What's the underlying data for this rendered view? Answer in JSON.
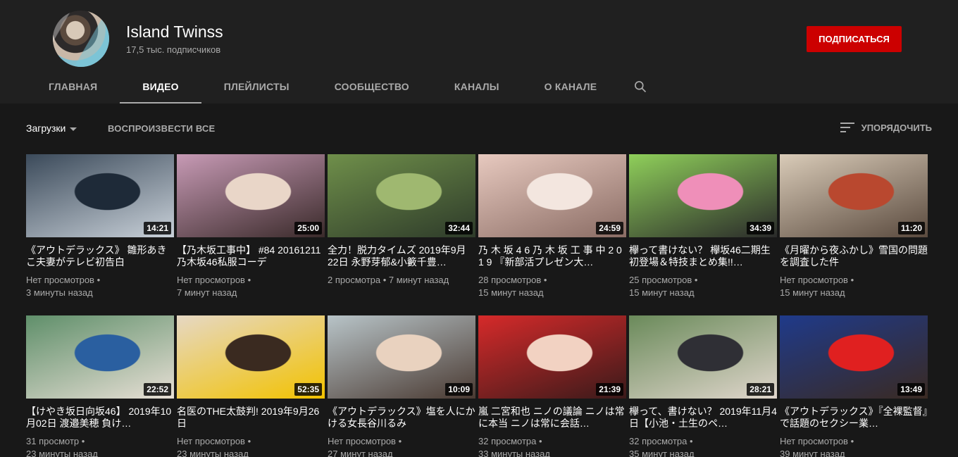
{
  "channel": {
    "name": "Island Twinss",
    "subscribers": "17,5 тыс. подписчиков",
    "subscribe_label": "ПОДПИСАТЬСЯ"
  },
  "tabs": [
    {
      "label": "ГЛАВНАЯ"
    },
    {
      "label": "ВИДЕО"
    },
    {
      "label": "ПЛЕЙЛИСТЫ"
    },
    {
      "label": "СООБЩЕСТВО"
    },
    {
      "label": "КАНАЛЫ"
    },
    {
      "label": "О КАНАЛЕ"
    }
  ],
  "filter": {
    "uploads_label": "Загрузки",
    "play_all_label": "ВОСПРОИЗВЕСТИ ВСЕ",
    "sort_label": "УПОРЯДОЧИТЬ"
  },
  "videos": [
    {
      "title": "《アウトデラックス》 雛形あきこ夫妻がテレビ初告白",
      "duration": "14:21",
      "views": "Нет просмотров •",
      "age": "3 минуты назад",
      "colors": [
        "#3b4a5a",
        "#1e2a38",
        "#c8d0d8"
      ]
    },
    {
      "title": "【乃木坂工事中】 #84 20161211 乃木坂46私服コーデ",
      "duration": "25:00",
      "views": "Нет просмотров •",
      "age": "7 минут назад",
      "colors": [
        "#c79ab5",
        "#e9d6c8",
        "#3a2a2a"
      ]
    },
    {
      "title": "全力！脱力タイムズ 2019年9月22日 永野芽郁&小籔千豊…",
      "duration": "32:44",
      "views": "2 просмотра • 7 минут назад",
      "age": "",
      "colors": [
        "#6f8f4a",
        "#9fb870",
        "#2e3b2a"
      ]
    },
    {
      "title": "乃 木 坂 4 6 乃 木 坂 工 事 中 2 0 1 9 『新部活プレゼン大…",
      "duration": "24:59",
      "views": "28 просмотров •",
      "age": "15 минут назад",
      "colors": [
        "#e7c9bf",
        "#f3e6df",
        "#8a6c64"
      ]
    },
    {
      "title": "欅って書けない？ 欅坂46二期生初登場＆特技まとめ集!!…",
      "duration": "34:39",
      "views": "25 просмотров •",
      "age": "15 минут назад",
      "colors": [
        "#8fcf5a",
        "#ef8fb9",
        "#2a2a2a"
      ]
    },
    {
      "title": "《月曜から夜ふかし》雪国の問題を調査した件",
      "duration": "11:20",
      "views": "Нет просмотров •",
      "age": "15 минут назад",
      "colors": [
        "#d9cbb8",
        "#b9482f",
        "#5a4a3e"
      ]
    },
    {
      "title": "【けやき坂日向坂46】 2019年10月02日 渡邉美穂 負け…",
      "duration": "22:52",
      "views": "31 просмотр •",
      "age": "23 минуты назад",
      "colors": [
        "#5f8f6a",
        "#2a5fa0",
        "#e7dfd5"
      ]
    },
    {
      "title": "名医のTHE太鼓判! 2019年9月26日",
      "duration": "52:35",
      "views": "Нет просмотров •",
      "age": "23 минуты назад",
      "colors": [
        "#e6d8c4",
        "#3a2a20",
        "#f2c200"
      ]
    },
    {
      "title": "《アウトデラックス》塩を人にかける女長谷川るみ",
      "duration": "10:09",
      "views": "Нет просмотров •",
      "age": "27 минут назад",
      "colors": [
        "#b8c4c8",
        "#e9d2bf",
        "#4a3a32"
      ]
    },
    {
      "title": "嵐 二宮和也 ニノの議論 ニノは常に本当 ニノは常に会話…",
      "duration": "21:39",
      "views": "32 просмотра •",
      "age": "33 минуты назад",
      "colors": [
        "#d62a2a",
        "#f2d2c2",
        "#3a1a1a"
      ]
    },
    {
      "title": "欅って、書けない？ 2019年11月4日【小池・土生のペ…",
      "duration": "28:21",
      "views": "32 просмотра •",
      "age": "35 минут назад",
      "colors": [
        "#6a8a5a",
        "#2f2f35",
        "#e0d6cc"
      ]
    },
    {
      "title": "《アウトデラックス》『全裸監督』で話題のセクシー業…",
      "duration": "13:49",
      "views": "Нет просмотров •",
      "age": "39 минут назад",
      "colors": [
        "#1f3a8a",
        "#e02020",
        "#3a2a22"
      ]
    }
  ]
}
